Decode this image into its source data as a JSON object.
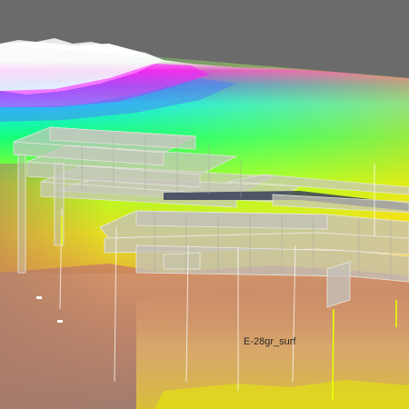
{
  "viewer": {
    "background_color": "#6b6b6b",
    "surface_label": "E-28gr_surf"
  },
  "palette": {
    "colormap": [
      "#ffffff",
      "#ff00ff",
      "#3b6bff",
      "#00e5ff",
      "#00ff6a",
      "#b8ff00",
      "#ffd800",
      "#ff8a00"
    ],
    "lower_surface": [
      "#d47a4e",
      "#e0a070",
      "#f0c060",
      "#ffe000"
    ],
    "section_fill": "#c8c6be",
    "section_edge": "#e8e6e0",
    "trench_color": "#3a3e5c"
  }
}
